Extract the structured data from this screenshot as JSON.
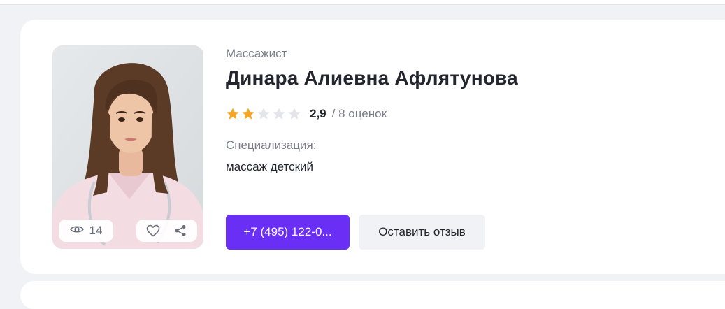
{
  "doctor": {
    "profession": "Массажист",
    "name": "Динара Алиевна Афлятунова",
    "rating_value": "2,9",
    "rating_stars": 2.9,
    "rating_max": 5,
    "reviews_count": "/ 8 оценок",
    "specialization_label": "Специализация:",
    "specialization_value": "массаж детский"
  },
  "photo": {
    "views_count": "14",
    "icons": {
      "views": "eye-icon",
      "favorite": "heart-icon",
      "share": "share-icon"
    }
  },
  "actions": {
    "phone_label": "+7 (495) 122-0...",
    "review_label": "Оставить отзыв"
  },
  "colors": {
    "accent": "#6a2ff4",
    "star_filled": "#f6a623",
    "star_empty": "#e3e5ea",
    "secondary_button_bg": "#f1f2f6"
  }
}
